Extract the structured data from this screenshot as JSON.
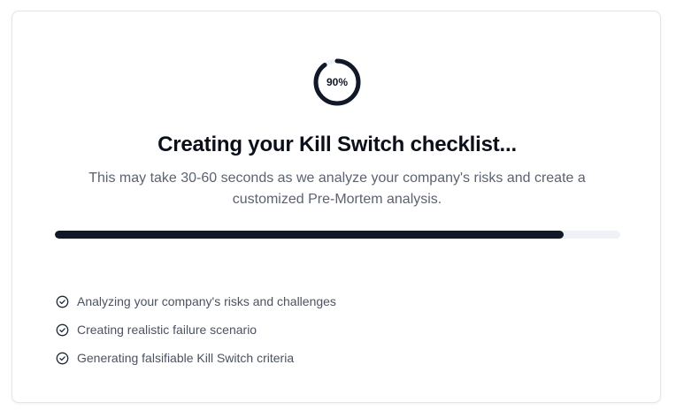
{
  "loader": {
    "percent_label": "90%",
    "progress": 0.9
  },
  "title": "Creating your Kill Switch checklist...",
  "subtitle": "This may take 30-60 seconds as we analyze your company's risks and create a customized Pre-Mortem analysis.",
  "progress_bar": {
    "progress": 0.9
  },
  "steps": [
    {
      "label": "Analyzing your company's risks and challenges",
      "icon": "check-circle-icon"
    },
    {
      "label": "Creating realistic failure scenario",
      "icon": "check-circle-icon"
    },
    {
      "label": "Generating falsifiable Kill Switch criteria",
      "icon": "check-circle-icon"
    }
  ],
  "colors": {
    "accent": "#111827",
    "track": "#eef1f5",
    "text_muted": "#5b6270"
  }
}
